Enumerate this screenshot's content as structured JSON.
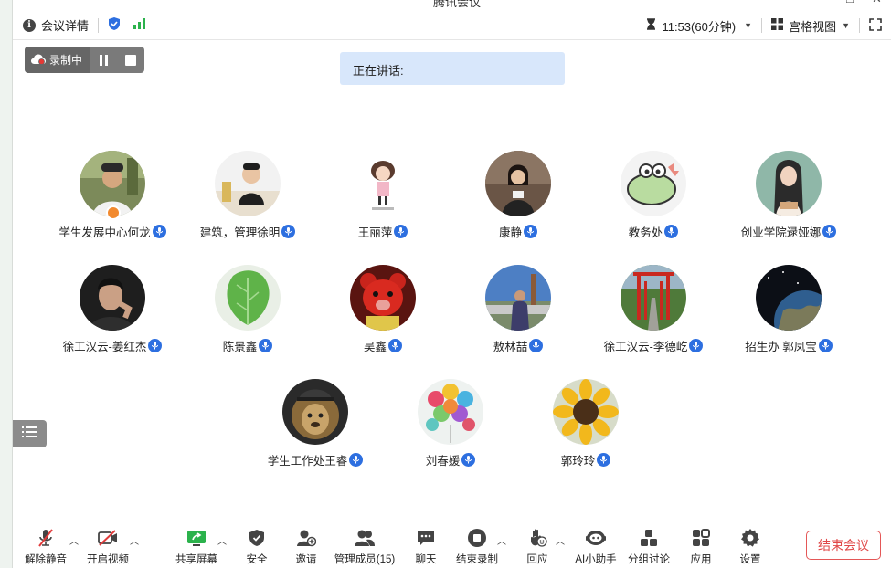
{
  "window": {
    "title": "腾讯会议"
  },
  "topbar": {
    "meeting_details": "会议详情",
    "time": "11:53(60分钟)",
    "view_mode": "宫格视图",
    "shield_color": "#2d6fe0",
    "signal_color": "#2bb24c"
  },
  "recording": {
    "label": "录制中"
  },
  "speaking": {
    "label": "正在讲话:"
  },
  "participants": [
    {
      "name": "学生发展中心何龙",
      "avatar": "man-photo",
      "host": true
    },
    {
      "name": "建筑，管理徐明",
      "avatar": "boy-at-desk"
    },
    {
      "name": "王丽萍",
      "avatar": "cartoon-girl"
    },
    {
      "name": "康静",
      "avatar": "woman-speaker"
    },
    {
      "name": "教务处",
      "avatar": "cartoon-dinosaur"
    },
    {
      "name": "创业学院逯娅娜",
      "avatar": "illustrated-girl"
    },
    {
      "name": "徐工汉云-姜红杰",
      "avatar": "man-dark-portrait"
    },
    {
      "name": "陈景鑫",
      "avatar": "green-leaf"
    },
    {
      "name": "吴鑫",
      "avatar": "red-teddy-bear"
    },
    {
      "name": "敖林喆",
      "avatar": "outdoor-person"
    },
    {
      "name": "徐工汉云-李德屹",
      "avatar": "red-gate-path"
    },
    {
      "name": "招生办 郭凤宝",
      "avatar": "earth-from-space"
    },
    {
      "name": "学生工作处王睿",
      "avatar": "lion-with-cap"
    },
    {
      "name": "刘春媛",
      "avatar": "colorful-balloons"
    },
    {
      "name": "郭玲玲",
      "avatar": "sunflower"
    }
  ],
  "toolbar": {
    "unmute": "解除静音",
    "start_video": "开启视频",
    "share_screen": "共享屏幕",
    "security": "安全",
    "invite": "邀请",
    "manage_members": "管理成员(15)",
    "chat": "聊天",
    "end_recording": "结束录制",
    "react": "回应",
    "ai_assistant": "AI小助手",
    "breakout": "分组讨论",
    "apps": "应用",
    "settings": "设置",
    "end_meeting": "结束会议"
  }
}
